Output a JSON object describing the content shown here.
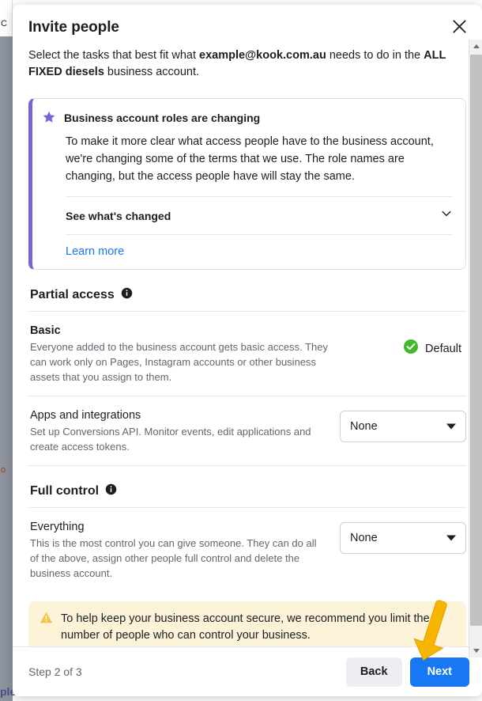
{
  "background": {
    "fragments": [
      "C",
      "o",
      "ple"
    ]
  },
  "modal": {
    "title": "Invite people",
    "close_icon": "close-icon",
    "subtitle": {
      "part1": "Select the tasks that best fit what ",
      "bold1": "example@kook.com.au",
      "part2": " needs to do in the ",
      "bold2": "ALL FIXED diesels",
      "part3": " business account."
    },
    "notice": {
      "icon": "star-icon",
      "accent_color": "#7a63d8",
      "title": "Business account roles are changing",
      "body": "To make it more clear what access people have to the business account, we're changing some of the terms that we use. The role names are changing, but the access people have will stay the same.",
      "expand_label": "See what's changed",
      "expand_icon": "chevron-down-icon",
      "link_label": "Learn more"
    },
    "sections": [
      {
        "title": "Partial access",
        "info_icon": "info-icon",
        "rows": [
          {
            "name": "Basic",
            "name_bold": true,
            "description": "Everyone added to the business account gets basic access. They can work only on Pages, Instagram accounts or other business assets that you assign to them.",
            "control": "badge",
            "badge_label": "Default",
            "badge_icon": "check-circle-icon",
            "badge_color": "#42b72a"
          },
          {
            "name": "Apps and integrations",
            "name_bold": false,
            "description": "Set up Conversions API. Monitor events, edit applications and create access tokens.",
            "control": "select",
            "select_value": "None"
          }
        ]
      },
      {
        "title": "Full control",
        "info_icon": "info-icon",
        "rows": [
          {
            "name": "Everything",
            "name_bold": false,
            "description": "This is the most control you can give someone. They can do all of the above, assign other people full control and delete the business account.",
            "control": "select",
            "select_value": "None"
          }
        ]
      }
    ],
    "warning": {
      "icon": "warning-triangle-icon",
      "background_color": "#fdf3d9",
      "text": "To help keep your business account secure, we recommend you limit the number of people who can control your business."
    },
    "footer": {
      "step_text": "Step 2 of 3",
      "back_label": "Back",
      "next_label": "Next",
      "next_color": "#1877f2"
    }
  },
  "scrollbar": {
    "up_icon": "scroll-up-arrow-icon",
    "down_icon": "scroll-down-arrow-icon",
    "thumb": "scrollbar-thumb"
  },
  "annotation": {
    "arrow_icon": "pointer-arrow-icon",
    "arrow_color": "#f7b500"
  }
}
